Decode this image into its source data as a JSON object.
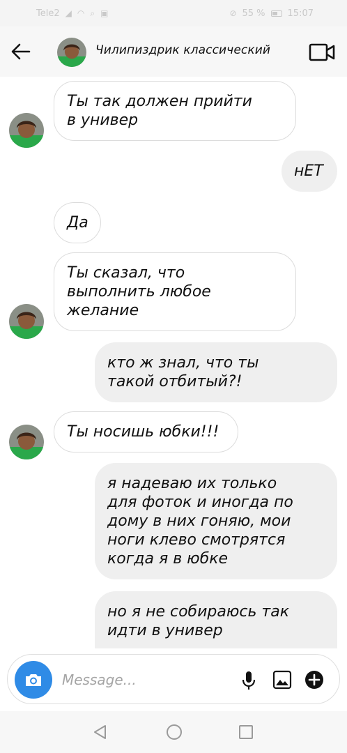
{
  "status_bar": {
    "carrier": "Tele2",
    "battery": "55 %",
    "time": "15:07"
  },
  "header": {
    "title": "Чилипиздрик классический",
    "back_icon": "arrow-left-icon",
    "video_icon": "video-camera-icon"
  },
  "messages": [
    {
      "side": "in",
      "text": "Ты так должен прийти\nв универ"
    },
    {
      "side": "out",
      "text": "нЕТ"
    },
    {
      "side": "in",
      "text": "Да"
    },
    {
      "side": "in",
      "text": "Ты сказал, что\nвыполнить любое\nжелание"
    },
    {
      "side": "out",
      "text": "кто ж знал, что ты\nтакой отбитый?!"
    },
    {
      "side": "in",
      "text": "Ты носишь юбки!!!"
    },
    {
      "side": "out",
      "text": "я надеваю их только\nдля фоток и иногда по\nдому в них гоняю, мои\nноги клево смотрятся\nкогда я в юбке"
    },
    {
      "side": "out",
      "text": "но я не собираюсь так\nидти в универ"
    }
  ],
  "composer": {
    "placeholder": "Message...",
    "value": "",
    "accent": "#2f8be6"
  },
  "nav_bar": {
    "icons": [
      "triangle-back-icon",
      "circle-home-icon",
      "square-recents-icon"
    ]
  },
  "colors": {
    "incoming_bubble": "#ffffff",
    "outgoing_bubble": "#efefef",
    "header_bg": "#f7f7f7"
  }
}
